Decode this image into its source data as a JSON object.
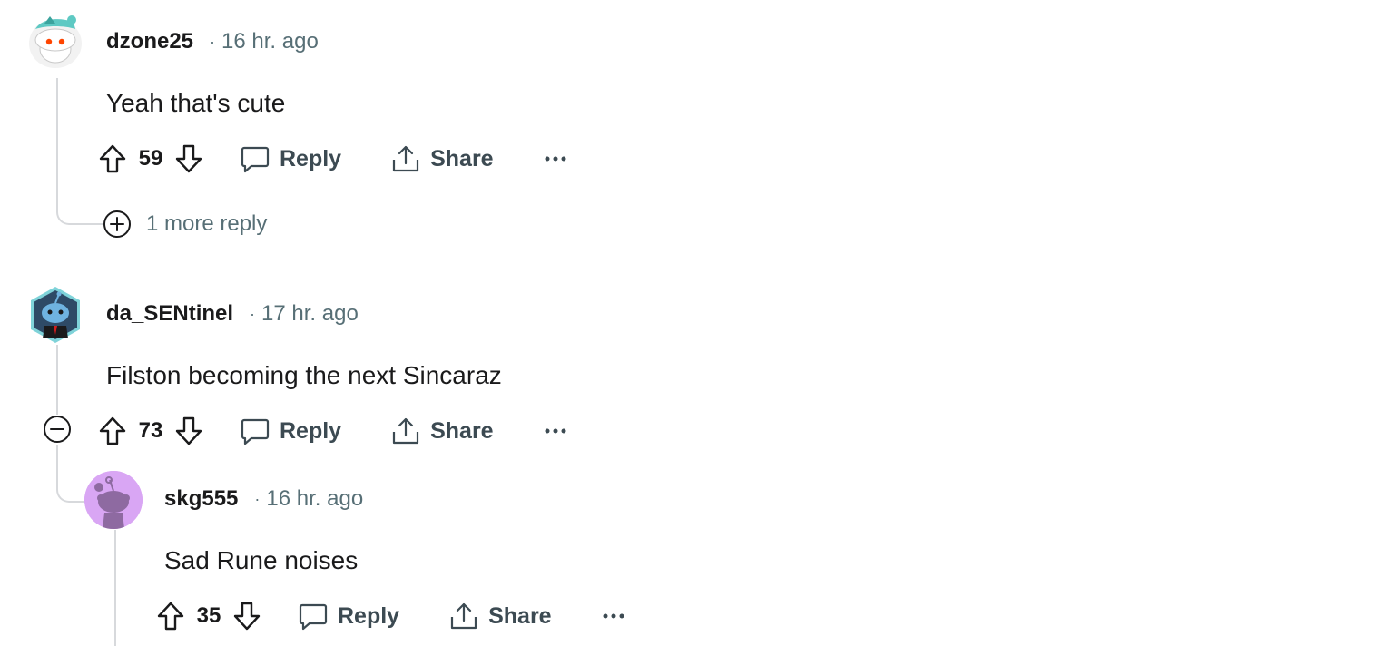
{
  "comments": [
    {
      "username": "dzone25",
      "time": "16 hr. ago",
      "body": "Yeah that's cute",
      "score": "59",
      "reply_label": "Reply",
      "share_label": "Share",
      "more_replies": "1 more reply"
    },
    {
      "username": "da_SENtinel",
      "time": "17 hr. ago",
      "body": "Filston becoming the next Sincaraz",
      "score": "73",
      "reply_label": "Reply",
      "share_label": "Share"
    },
    {
      "username": "skg555",
      "time": "16 hr. ago",
      "body": "Sad Rune noises",
      "score": "35",
      "reply_label": "Reply",
      "share_label": "Share"
    }
  ],
  "separator": "·",
  "icons": {
    "upvote": "arrow-up-icon",
    "downvote": "arrow-down-icon",
    "reply": "speech-bubble-icon",
    "share": "share-upload-icon",
    "more": "ellipsis-icon",
    "expand": "plus-circle-icon",
    "collapse": "minus-circle-icon"
  },
  "colors": {
    "thread_line": "#d7d9dc",
    "meta_gray": "#576f76",
    "action_gray": "#3c4a52",
    "avatar_purple": "#d9a6f4"
  }
}
